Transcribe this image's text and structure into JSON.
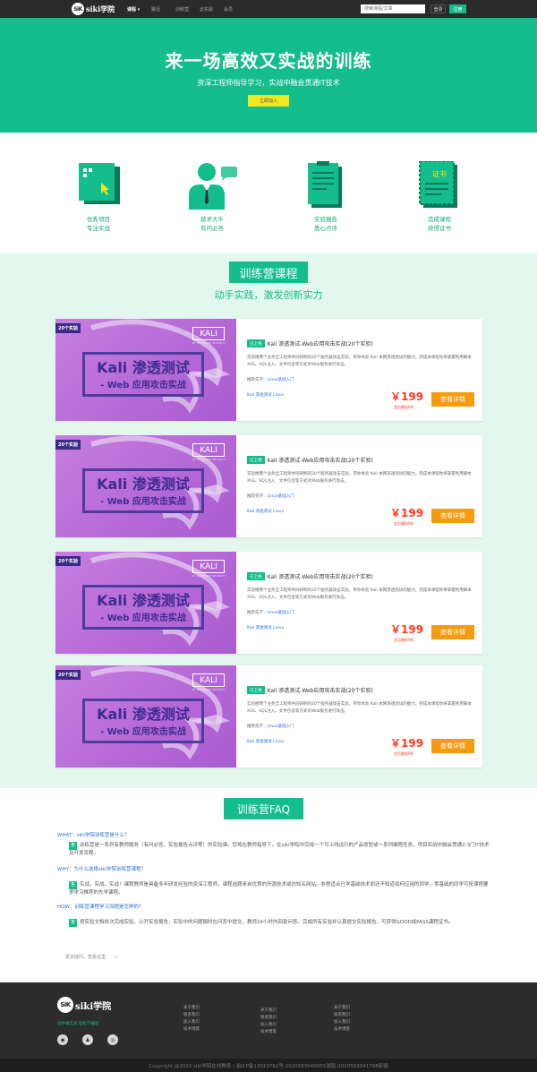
{
  "nav": {
    "logo_mark": "SiK",
    "logo_text": "siki学院",
    "items": [
      {
        "label": "课程 ▾",
        "active": true
      },
      {
        "label": "路径",
        "active": false
      },
      {
        "label": "训练营",
        "active": false
      },
      {
        "label": "云实验",
        "active": false
      },
      {
        "label": "会员",
        "active": false
      }
    ],
    "search_placeholder": "搜索课程/文章",
    "login": "登录",
    "register": "注册"
  },
  "hero": {
    "title": "来一场高效又实战的训练",
    "subtitle": "资深工程师指导学习，实战中融会贯通IT技术",
    "button": "立即加入"
  },
  "features": [
    {
      "icon": "screen-cursor-icon",
      "line1": "优秀项目",
      "line2": "专注实战"
    },
    {
      "icon": "teacher-icon",
      "line1": "技术大牛",
      "line2": "有问必答"
    },
    {
      "icon": "report-icon",
      "line1": "实验报告",
      "line2": "悉心点评"
    },
    {
      "icon": "certificate-icon",
      "line1": "完成课程",
      "line2": "获得证书",
      "cert_text": "证书"
    }
  ],
  "camp": {
    "title": "训练营课程",
    "subtitle": "动手实践，激发创新实力",
    "courses": [
      {
        "badge": "20个实验",
        "kali_logo": "KALI",
        "kali_small": "BY OFFENSIVE SECURITY",
        "cover_title": "Kali 渗透测试",
        "cover_sub": "- Web 应用攻击实战",
        "status": "已上线",
        "title": "Kali 渗透测试-Web应用攻击实战(20个实验)",
        "desc": "实验楼两个业务全工程师共同研制的20个服务器攻击实验，带你体验 Kali 本网渗透测试的魅力。完成本课程你将掌握利用脚本XSS、SQL注入、文件包含等方式对Web服务进行攻击。",
        "prereq_label": "推荐先学：",
        "prereq_link": "Linux基础入门",
        "tags": "Kali  渗透测试  Linux",
        "price": "￥199",
        "vip": "会员最低9折",
        "button": "查看详情"
      },
      {
        "badge": "20个实验",
        "kali_logo": "KALI",
        "kali_small": "BY OFFENSIVE SECURITY",
        "cover_title": "Kali 渗透测试",
        "cover_sub": "- Web 应用攻击实战",
        "status": "已上线",
        "title": "Kali 渗透测试-Web应用攻击实战(20个实验)",
        "desc": "实验楼两个业务全工程师共同研制的20个服务器攻击实验，带你体验 Kali 本网渗透测试的魅力。完成本课程你将掌握利用脚本XSS、SQL注入、文件包含等方式对Web服务进行攻击。",
        "prereq_label": "推荐先学：",
        "prereq_link": "Linux基础入门",
        "tags": "Kali  渗透测试  Linux",
        "price": "￥199",
        "vip": "会员最低9折",
        "button": "查看详情"
      },
      {
        "badge": "20个实验",
        "kali_logo": "KALI",
        "kali_small": "BY OFFENSIVE SECURITY",
        "cover_title": "Kali 渗透测试",
        "cover_sub": "- Web 应用攻击实战",
        "status": "已上线",
        "title": "Kali 渗透测试-Web应用攻击实战(20个实验)",
        "desc": "实验楼两个业务全工程师共同研制的20个服务器攻击实验，带你体验 Kali 本网渗透测试的魅力。完成本课程你将掌握利用脚本XSS、SQL注入、文件包含等方式对Web服务进行攻击。",
        "prereq_label": "推荐先学：",
        "prereq_link": "Linux基础入门",
        "tags": "Kali  渗透测试  Linux",
        "price": "￥199",
        "vip": "会员最低9折",
        "button": "查看详情"
      },
      {
        "badge": "20个实验",
        "kali_logo": "KALI",
        "kali_small": "BY OFFENSIVE SECURITY",
        "cover_title": "Kali 渗透测试",
        "cover_sub": "- Web 应用攻击实战",
        "status": "已上线",
        "title": "Kali 渗透测试-Web应用攻击实战(20个实验)",
        "desc": "实验楼两个业务全工程师共同研制的20个服务器攻击实验，带你体验 Kali 本网渗透测试的魅力。完成本课程你将掌握利用脚本XSS、SQL注入、文件包含等方式对Web服务进行攻击。",
        "prereq_label": "推荐先学：",
        "prereq_link": "Linux基础入门",
        "tags": "Kali  渗透测试  Linux",
        "price": "￥199",
        "vip": "会员最低9折",
        "button": "查看详情"
      }
    ]
  },
  "faq": {
    "title": "训练营FAQ",
    "items": [
      {
        "q": "WHAT：siki学院训练营是什么？",
        "a_badge": "答",
        "a": "训练营是一系列有教师服务（有问必答，实验报告点评等）的实验课。您将在教师指导下，在siki学院中完成一个可上线运行的产品原型或一系列编程任务，项目实战中融会贯通2-3门IT技术及开发流程。"
      },
      {
        "q": "WHY：为什么选择siki学院训练营课程？",
        "a_badge": "答",
        "a": "实战，实战，实战！课程教师是具备多年研发经验的资深工程师，课程选题来自优秀的开源技术或仿知名网站。非常适合已学基础技术却还不知道如何应用的同学，零基础的同学可按课程要求学习推荐的先学课程。"
      },
      {
        "q": "HOW：训练营课程学习流程是怎样的？",
        "a_badge": "答",
        "a": "按实验文档依次完成实验，公开实验报告，实验中的问题随时在问答中提交，教师24小时内回复问答。完成所有实验并认真提交实验报告，可获得GOOD或PASS课程证书。"
      }
    ],
    "more": "更多疑问，查看这里",
    "more_arrow": "››"
  },
  "footer": {
    "logo_mark": "SiK",
    "logo_text": "siki学院",
    "slogan": "动手做实验  轻松学编程",
    "social": [
      "weibo-icon",
      "qq-icon",
      "wechat-icon"
    ],
    "social_glyphs": [
      "◉",
      "♟",
      "◎"
    ],
    "cols": [
      [
        "关于我们",
        "联系我们",
        "加入我们",
        "技术博客"
      ],
      [
        "关于我们",
        "联系我们",
        "加入我们",
        "技术博客"
      ],
      [
        "关于我们",
        "联系我们",
        "加入我们",
        "技术博客"
      ]
    ],
    "copyright": "Copyright @2022 siki学院在线教育 | 渝ICP备13019762号-2020583040055湖南-2020583041708新疆"
  },
  "colors": {
    "brand_green": "#14bd8c",
    "price_red": "#ff3a20",
    "cta_orange": "#f59b10",
    "hero_button_yellow": "#f2e81e",
    "nav_bg": "#2a2a2a"
  }
}
